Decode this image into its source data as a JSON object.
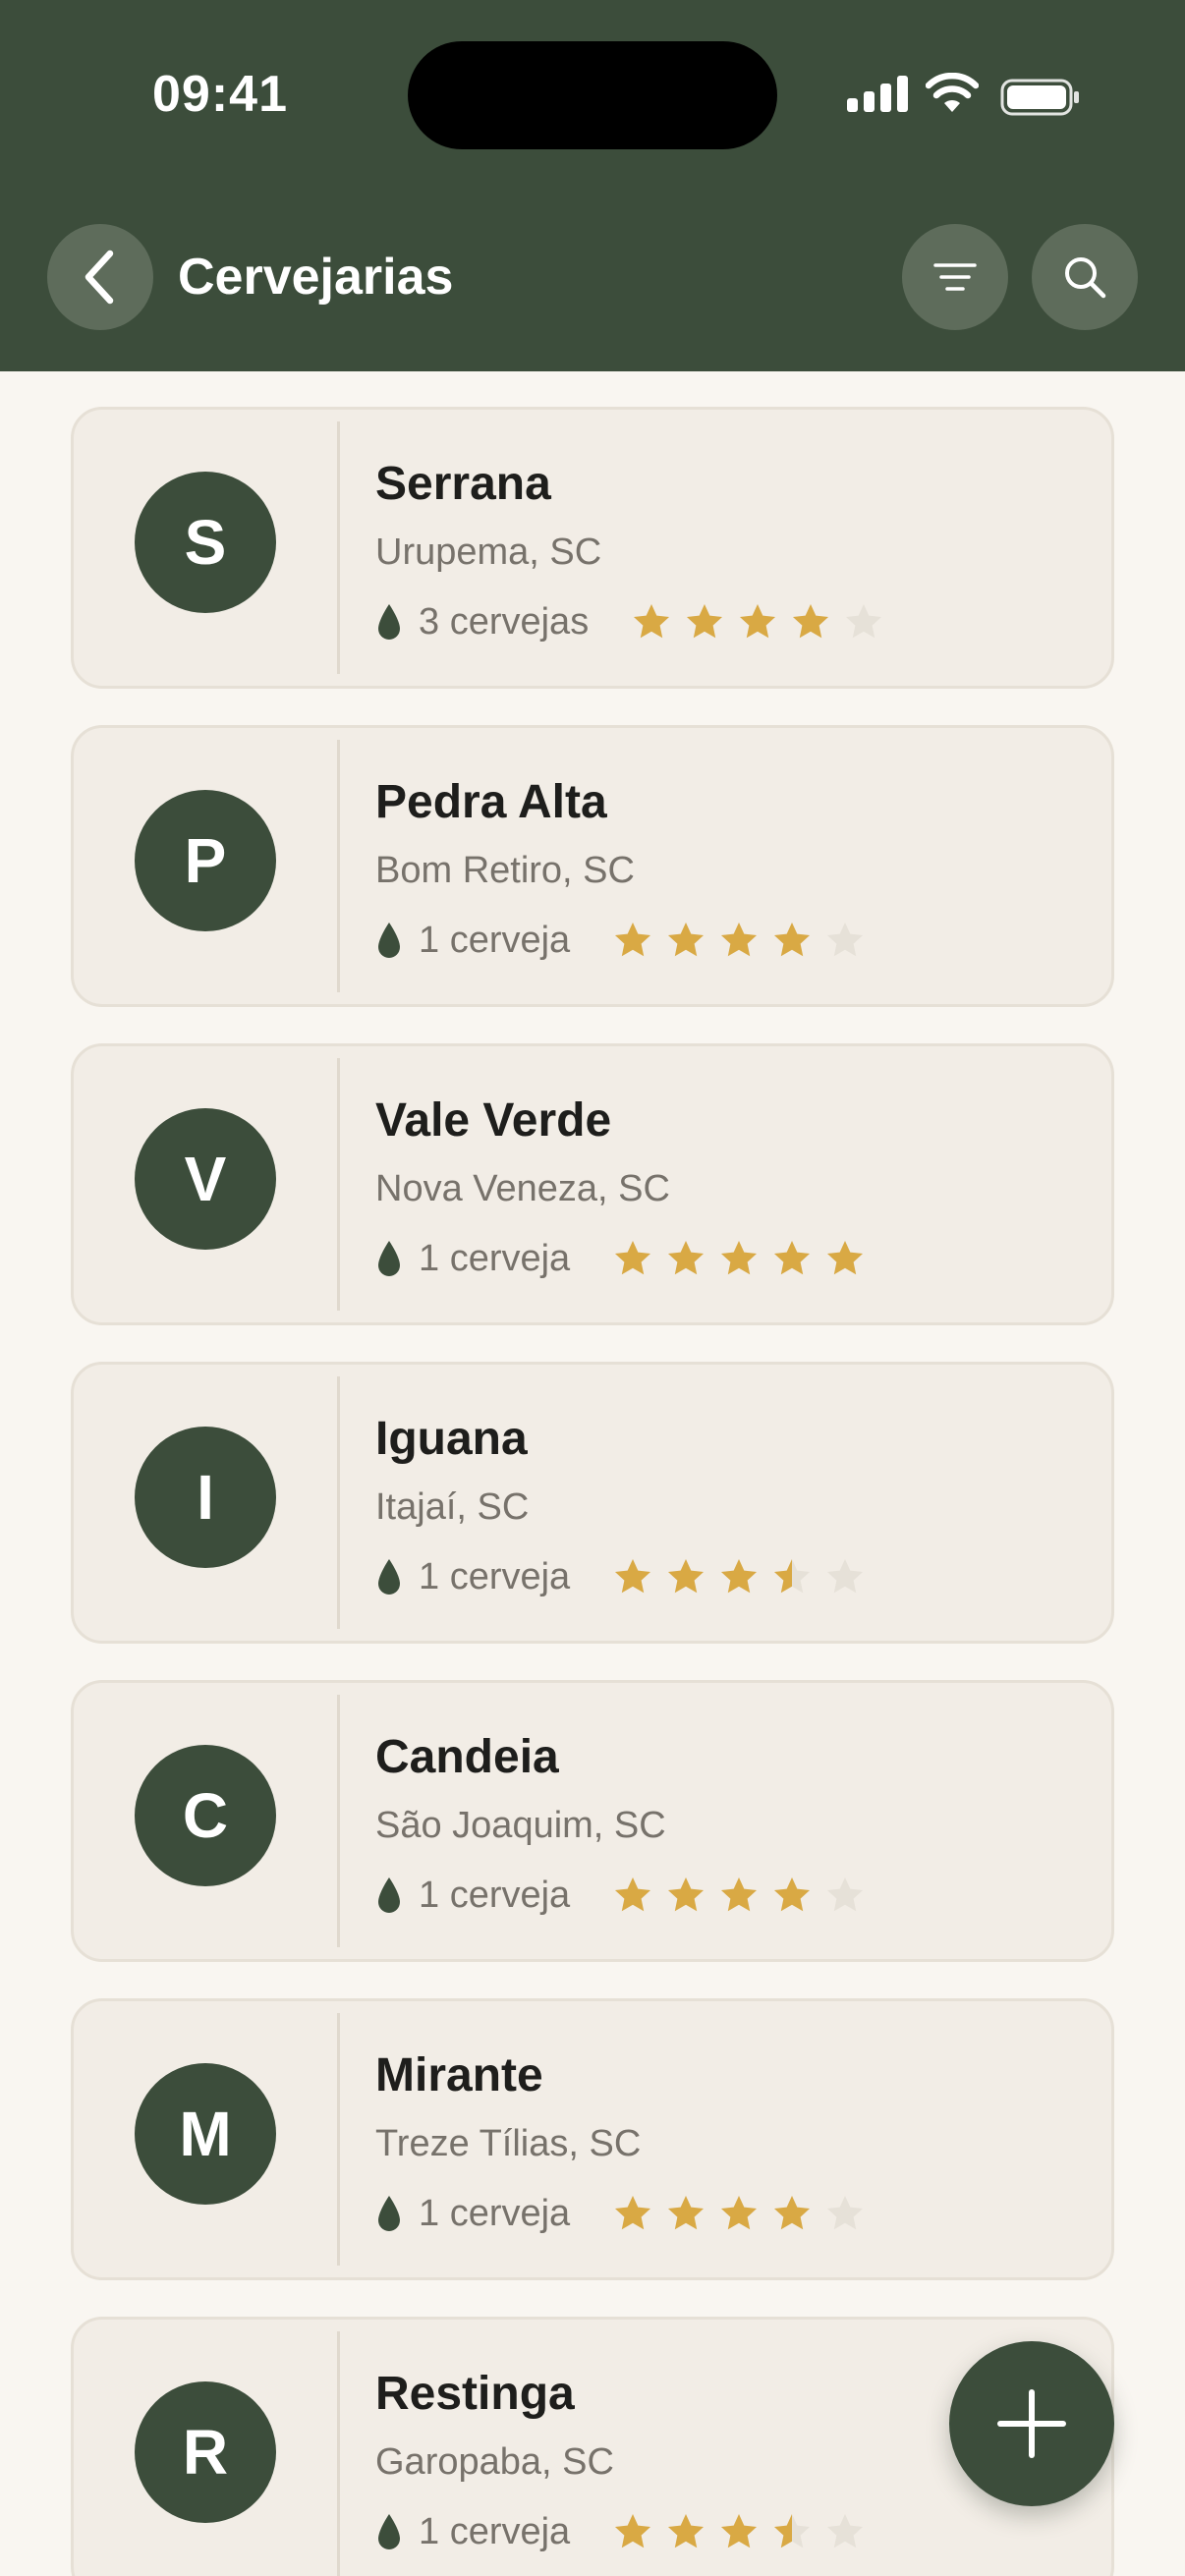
{
  "status_bar": {
    "time": "09:41",
    "icons": [
      "signal-icon",
      "wifi-icon",
      "battery-icon"
    ]
  },
  "header": {
    "title": "Cervejarias",
    "back_icon": "chevron-left-icon",
    "filter_icon": "filter-icon",
    "search_icon": "search-icon"
  },
  "colors": {
    "header_bg": "#3C4D3B",
    "page_bg": "#F9F6F1",
    "card_bg": "#F2EDE6",
    "accent": "#3C4D3B",
    "star_filled": "#D9A944",
    "star_empty": "#E6E1D8",
    "muted_text": "#77726B"
  },
  "breweries": [
    {
      "initial": "S",
      "name": "Serrana",
      "location": "Urupema, SC",
      "beers": "3 cervejas",
      "rating": 4
    },
    {
      "initial": "P",
      "name": "Pedra Alta",
      "location": "Bom Retiro, SC",
      "beers": "1 cerveja",
      "rating": 4
    },
    {
      "initial": "V",
      "name": "Vale Verde",
      "location": "Nova Veneza, SC",
      "beers": "1 cerveja",
      "rating": 5
    },
    {
      "initial": "I",
      "name": "Iguana",
      "location": "Itajaí, SC",
      "beers": "1 cerveja",
      "rating": 3.5
    },
    {
      "initial": "C",
      "name": "Candeia",
      "location": "São Joaquim, SC",
      "beers": "1 cerveja",
      "rating": 4
    },
    {
      "initial": "M",
      "name": "Mirante",
      "location": "Treze Tílias, SC",
      "beers": "1 cerveja",
      "rating": 4
    },
    {
      "initial": "R",
      "name": "Restinga",
      "location": "Garopaba, SC",
      "beers": "1 cerveja",
      "rating": 3.5
    }
  ],
  "fab": {
    "icon": "plus-icon"
  }
}
